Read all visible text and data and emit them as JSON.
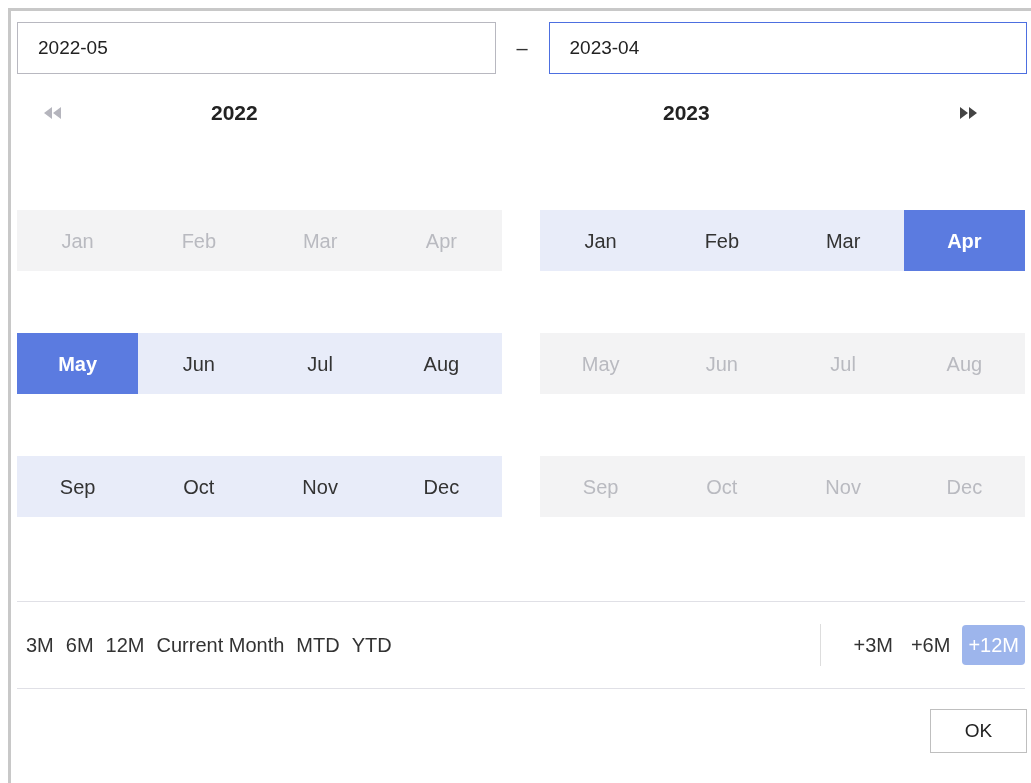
{
  "range_inputs": [
    {
      "value": "2022-05",
      "focused": false
    },
    {
      "value": "2023-04",
      "focused": true
    }
  ],
  "separator": "–",
  "panels": [
    {
      "year": "2022",
      "prev_arrow": true,
      "months": [
        {
          "label": "Jan",
          "disabled": true,
          "in_range": false,
          "selected": false
        },
        {
          "label": "Feb",
          "disabled": true,
          "in_range": false,
          "selected": false
        },
        {
          "label": "Mar",
          "disabled": true,
          "in_range": false,
          "selected": false
        },
        {
          "label": "Apr",
          "disabled": true,
          "in_range": false,
          "selected": false
        },
        {
          "label": "May",
          "disabled": false,
          "in_range": true,
          "selected": true
        },
        {
          "label": "Jun",
          "disabled": false,
          "in_range": true,
          "selected": false
        },
        {
          "label": "Jul",
          "disabled": false,
          "in_range": true,
          "selected": false
        },
        {
          "label": "Aug",
          "disabled": false,
          "in_range": true,
          "selected": false
        },
        {
          "label": "Sep",
          "disabled": false,
          "in_range": true,
          "selected": false
        },
        {
          "label": "Oct",
          "disabled": false,
          "in_range": true,
          "selected": false
        },
        {
          "label": "Nov",
          "disabled": false,
          "in_range": true,
          "selected": false
        },
        {
          "label": "Dec",
          "disabled": false,
          "in_range": true,
          "selected": false
        }
      ]
    },
    {
      "year": "2023",
      "next_arrow": true,
      "months": [
        {
          "label": "Jan",
          "disabled": false,
          "in_range": true,
          "selected": false
        },
        {
          "label": "Feb",
          "disabled": false,
          "in_range": true,
          "selected": false
        },
        {
          "label": "Mar",
          "disabled": false,
          "in_range": true,
          "selected": false
        },
        {
          "label": "Apr",
          "disabled": false,
          "in_range": true,
          "selected": true
        },
        {
          "label": "May",
          "disabled": true,
          "in_range": false,
          "selected": false
        },
        {
          "label": "Jun",
          "disabled": true,
          "in_range": false,
          "selected": false
        },
        {
          "label": "Jul",
          "disabled": true,
          "in_range": false,
          "selected": false
        },
        {
          "label": "Aug",
          "disabled": true,
          "in_range": false,
          "selected": false
        },
        {
          "label": "Sep",
          "disabled": true,
          "in_range": false,
          "selected": false
        },
        {
          "label": "Oct",
          "disabled": true,
          "in_range": false,
          "selected": false
        },
        {
          "label": "Nov",
          "disabled": true,
          "in_range": false,
          "selected": false
        },
        {
          "label": "Dec",
          "disabled": true,
          "in_range": false,
          "selected": false
        }
      ]
    }
  ],
  "shortcuts": [
    {
      "label": "3M",
      "selected": false
    },
    {
      "label": "6M",
      "selected": false
    },
    {
      "label": "12M",
      "selected": false
    },
    {
      "label": "Current Month",
      "selected": false
    },
    {
      "label": "MTD",
      "selected": false
    },
    {
      "label": "YTD",
      "selected": false
    }
  ],
  "offsets": [
    {
      "label": "+3M",
      "selected": false
    },
    {
      "label": "+6M",
      "selected": false
    },
    {
      "label": "+12M",
      "selected": true
    }
  ],
  "ok_button": "OK"
}
